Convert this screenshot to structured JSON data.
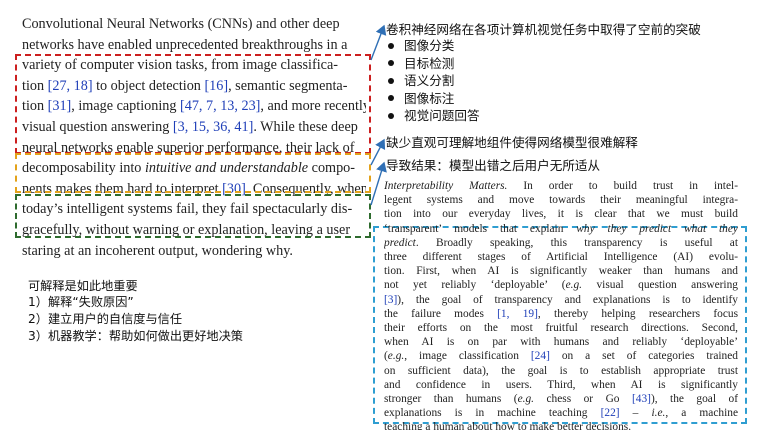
{
  "left_paragraph": {
    "lines": [
      [
        "Convolutional Neural Networks (CNNs) and other deep"
      ],
      [
        "networks have enabled unprecedented breakthroughs in a"
      ],
      [
        "variety of computer vision tasks, from image classifica-"
      ],
      [
        "tion ",
        {
          "ref": "[27, 18]"
        },
        " to object detection ",
        {
          "ref": "[16]"
        },
        ", semantic segmenta-"
      ],
      [
        "tion ",
        {
          "ref": "[31]"
        },
        ", image captioning ",
        {
          "ref": "[47, 7, 13, 23]"
        },
        ", and more recently,"
      ],
      [
        "visual question answering ",
        {
          "ref": "[3, 15, 36, 41]"
        },
        ". While these deep"
      ],
      [
        "neural networks enable superior performance, their lack of"
      ],
      [
        "decomposability into ",
        {
          "em": "intuitive and understandable"
        },
        " compo-"
      ],
      [
        "nents makes them hard to interpret ",
        {
          "ref": "[30]"
        },
        ". Consequently, when"
      ],
      [
        "today’s intelligent systems fail, they fail spectacularly dis-"
      ],
      [
        "gracefully, without warning or explanation, leaving a user"
      ],
      [
        "staring at an incoherent output, wondering why."
      ]
    ]
  },
  "annotations": {
    "title_cn": "卷积神经网络在各项计算机视觉任务中取得了空前的突破",
    "tasks_cn": [
      "图像分类",
      "目标检测",
      "语义分割",
      "图像标注",
      "视觉问题回答"
    ],
    "note_interpretability_cn": "缺少直观可理解地组件使得网络模型很难解释",
    "note_failure_cn": "导致结果：模型出错之后用户无所适从",
    "importance_title_cn": "可解释是如此地重要",
    "importance_items_cn": [
      "1）解释“失败原因”",
      "2）建立用户的自信度与信任",
      "3）机器教学：帮助如何做出更好地决策"
    ]
  },
  "right_paragraph": {
    "lines": [
      [
        {
          "em": "Interpretability Matters."
        },
        " In order to build trust in intel-"
      ],
      [
        "legent systems and move towards their meaningful integra-"
      ],
      [
        "tion into our everyday lives, it is clear that we must build"
      ],
      [
        "‘transparent’ models that explain ",
        {
          "em": "why they predict what they"
        }
      ],
      [
        {
          "em": "predict"
        },
        ". Broadly speaking, this transparency is useful at"
      ],
      [
        "three different stages of Artificial Intelligence (AI) evolu-"
      ],
      [
        "tion. First, when AI is significantly weaker than humans and"
      ],
      [
        "not yet reliably ‘deployable’ (",
        {
          "em": "e.g."
        },
        " visual question answering"
      ],
      [
        {
          "ref": "[3]"
        },
        "), the goal of transparency and explanations is to identify"
      ],
      [
        "the failure modes ",
        {
          "ref": "[1, 19]"
        },
        ", thereby helping researchers focus"
      ],
      [
        "their efforts on the most fruitful research directions. Second,"
      ],
      [
        "when AI is on par with humans and reliably ‘deployable’"
      ],
      [
        "(",
        {
          "em": "e.g."
        },
        ", image classification ",
        {
          "ref": "[24]"
        },
        " on a set of categories trained"
      ],
      [
        "on sufficient data), the goal is to establish appropriate trust"
      ],
      [
        "and confidence in users.  Third, when AI is significantly"
      ],
      [
        "stronger than humans (",
        {
          "em": "e.g."
        },
        " chess or Go ",
        {
          "ref": "[43]"
        },
        "), the goal of"
      ],
      [
        "explanations is in machine teaching ",
        {
          "ref": "[22]"
        },
        " – ",
        {
          "em": "i.e."
        },
        ", a machine"
      ],
      [
        "teaching a human about how to make better decisions."
      ]
    ]
  },
  "colors": {
    "ref_blue": "#1f3fb8",
    "box_red": "#cc1f1f",
    "box_gold": "#e3a21a",
    "box_green": "#2e6b2e",
    "box_blue": "#2f9ed1",
    "arrow": "#2f6fb5"
  }
}
